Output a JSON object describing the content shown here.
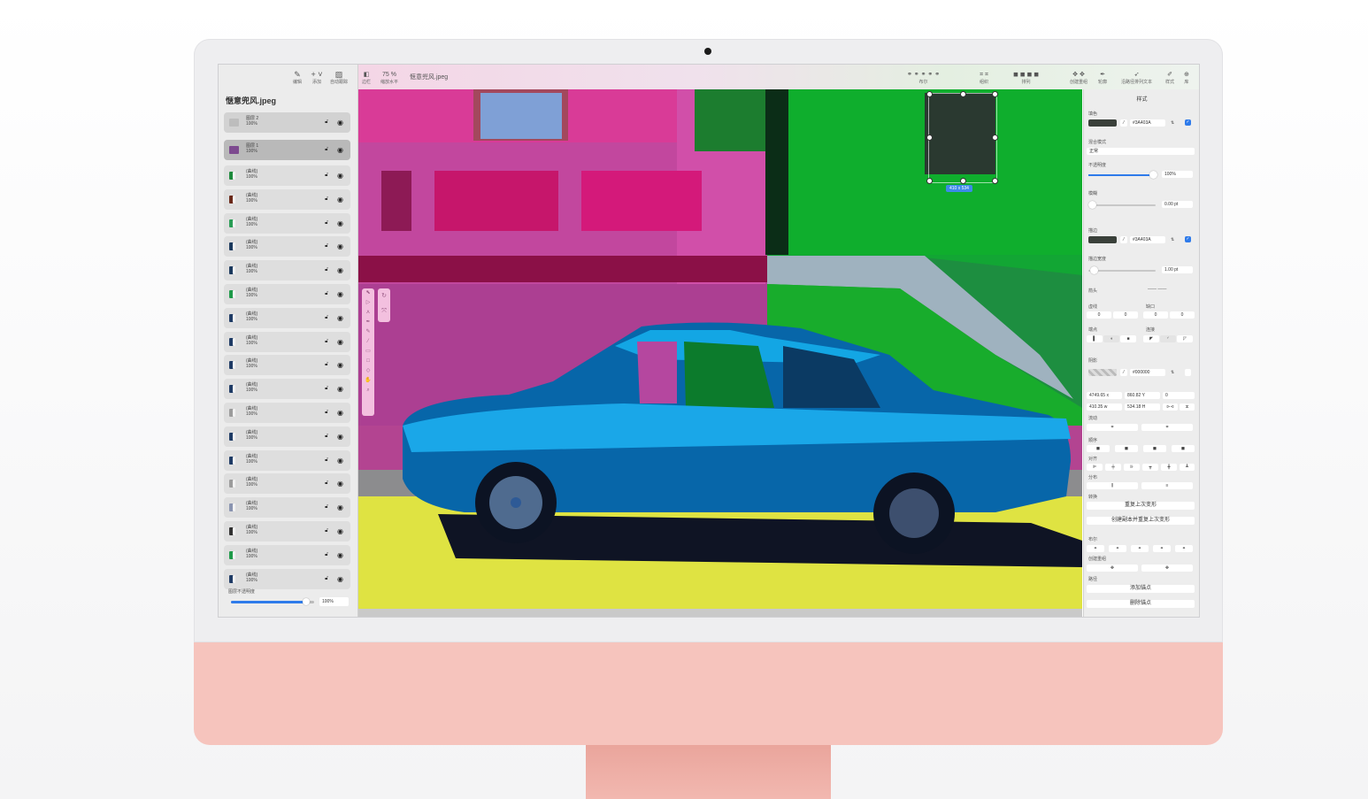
{
  "doc": {
    "title": "惬意兜风.jpeg"
  },
  "sidebar_tools": [
    {
      "icon": "pencil-icon",
      "label": "编辑"
    },
    {
      "icon": "plus-icon",
      "label": "添加"
    },
    {
      "icon": "auto-trace-icon",
      "label": "自动跟踪"
    }
  ],
  "layers": [
    {
      "name": "图层 2",
      "opacity": "100%",
      "kind": "group",
      "thumb": "#bdbdbd"
    },
    {
      "name": "图层 1",
      "opacity": "100%",
      "kind": "sel",
      "thumb": "#7d4a8f"
    },
    {
      "name": "(曲线)",
      "opacity": "100%",
      "kind": "item",
      "thumb": "#1e8a3c"
    },
    {
      "name": "(曲线)",
      "opacity": "100%",
      "kind": "item",
      "thumb": "#6b2a1a"
    },
    {
      "name": "(曲线)",
      "opacity": "100%",
      "kind": "item",
      "thumb": "#2a9d55"
    },
    {
      "name": "(曲线)",
      "opacity": "100%",
      "kind": "item",
      "thumb": "#1c3a5e"
    },
    {
      "name": "(曲线)",
      "opacity": "100%",
      "kind": "item",
      "thumb": "#1c3a5e"
    },
    {
      "name": "(曲线)",
      "opacity": "100%",
      "kind": "item",
      "thumb": "#1f9a4a"
    },
    {
      "name": "(曲线)",
      "opacity": "100%",
      "kind": "item",
      "thumb": "#203c66"
    },
    {
      "name": "(曲线)",
      "opacity": "100%",
      "kind": "item",
      "thumb": "#203c66"
    },
    {
      "name": "(曲线)",
      "opacity": "100%",
      "kind": "item",
      "thumb": "#203c66"
    },
    {
      "name": "(曲线)",
      "opacity": "100%",
      "kind": "item",
      "thumb": "#203c66"
    },
    {
      "name": "(曲线)",
      "opacity": "100%",
      "kind": "item",
      "thumb": "#9c9c9c"
    },
    {
      "name": "(曲线)",
      "opacity": "100%",
      "kind": "item",
      "thumb": "#203c66"
    },
    {
      "name": "(曲线)",
      "opacity": "100%",
      "kind": "item",
      "thumb": "#203c66"
    },
    {
      "name": "(曲线)",
      "opacity": "100%",
      "kind": "item",
      "thumb": "#9c9c9c"
    },
    {
      "name": "(曲线)",
      "opacity": "100%",
      "kind": "item",
      "thumb": "#8a94b0"
    },
    {
      "name": "(曲线)",
      "opacity": "100%",
      "kind": "item",
      "thumb": "#333333"
    },
    {
      "name": "(曲线)",
      "opacity": "100%",
      "kind": "item",
      "thumb": "#1f9a4a"
    },
    {
      "name": "(曲线)",
      "opacity": "100%",
      "kind": "item",
      "thumb": "#203c66"
    }
  ],
  "layer_opacity": {
    "label": "图层不透明度",
    "value": "100%",
    "level": 0.9
  },
  "topbar": {
    "sidebar_label": "边栏",
    "zoom_value": "75 %",
    "zoom_label": "缩放水平",
    "doc_title": "惬意兜风.jpeg",
    "right_items": [
      {
        "icon": "boolean-icon",
        "label": "布尔"
      },
      {
        "icon": "grid-icon",
        "label": "组织"
      },
      {
        "icon": "arrange-icon",
        "label": "排列"
      },
      {
        "icon": "group-icon",
        "label": "创建重组"
      },
      {
        "icon": "pen-icon",
        "label": "轮廓"
      },
      {
        "icon": "text-path-icon",
        "label": "沿路径排列文本"
      },
      {
        "icon": "style-icon",
        "label": "样式"
      },
      {
        "icon": "library-icon",
        "label": "库"
      }
    ]
  },
  "canvas": {
    "selection_size": "410 x 534"
  },
  "inspector": {
    "title": "样式",
    "fill_label": "填色",
    "fill_hex": "#3A403A",
    "fill_color": "#3a403a",
    "blend_label": "混合模式",
    "blend_value": "正常",
    "opacity_label": "不透明度",
    "opacity_value": "100%",
    "opacity_level": 0.98,
    "blur_label": "模糊",
    "blur_value": "0.00 pt",
    "stroke_label": "描边",
    "stroke_hex": "#3A403A",
    "stroke_color": "#3a403a",
    "stroke_width_label": "描边宽度",
    "stroke_width_value": "1.00 pt",
    "arrow_label": "箭头",
    "dash_label": "虚线",
    "gap_label": "缺口",
    "dash_values": [
      "0",
      "0",
      "0",
      "0"
    ],
    "cap_label": "端点",
    "join_label": "连接",
    "shadow_label": "阴影",
    "shadow_hex": "#000000",
    "x_value": "4749.65",
    "x_unit": "x",
    "y_value": "860.82",
    "y_unit": "Y",
    "angle_value": "0",
    "w_value": "410.35",
    "w_unit": "w",
    "h_value": "534.18",
    "h_unit": "H",
    "flow_label": "流动",
    "order_label": "顺序",
    "align_label": "对齐",
    "distribute_label": "分布",
    "transform_label": "转换",
    "repeat_transform": "重复上次变形",
    "duplicate_repeat": "创建副本并重复上次变形",
    "boolean_label": "布尔",
    "group_label": "创建重组",
    "path_label": "路径",
    "add_anchor": "添加锚点",
    "delete_anchor": "删除锚点"
  }
}
